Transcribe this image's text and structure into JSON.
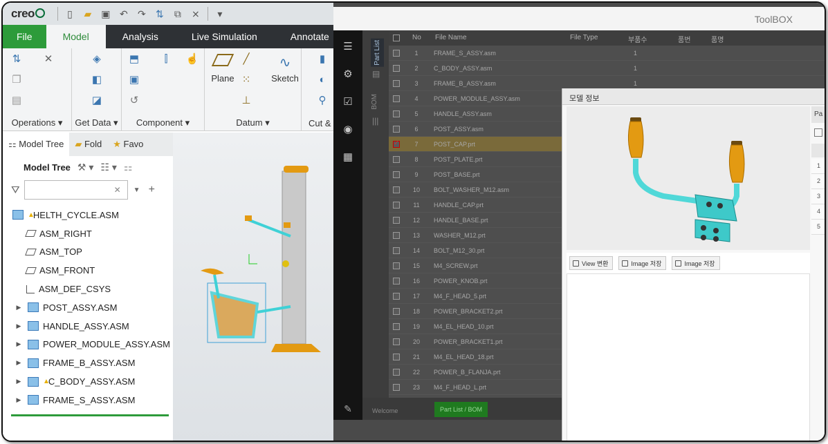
{
  "creo": {
    "logo": "creo",
    "tabs": [
      "File",
      "Model",
      "Analysis",
      "Live Simulation",
      "Annotate"
    ],
    "ribbon_groups": [
      "Operations",
      "Get Data",
      "Component",
      "Datum",
      "Cut &"
    ],
    "ribbon_buttons": {
      "plane": "Plane",
      "sketch": "Sketch"
    },
    "panel_tabs": [
      "Model Tree",
      "Fold",
      "Favo"
    ],
    "model_tree_label": "Model Tree",
    "filter_placeholder": "",
    "tree": [
      {
        "label": "HELTH_CYCLE.ASM",
        "type": "root",
        "warn": true
      },
      {
        "label": "ASM_RIGHT",
        "type": "plane"
      },
      {
        "label": "ASM_TOP",
        "type": "plane"
      },
      {
        "label": "ASM_FRONT",
        "type": "plane"
      },
      {
        "label": "ASM_DEF_CSYS",
        "type": "csys"
      },
      {
        "label": "POST_ASSY.ASM",
        "type": "asm"
      },
      {
        "label": "HANDLE_ASSY.ASM",
        "type": "asm"
      },
      {
        "label": "POWER_MODULE_ASSY.ASM",
        "type": "asm"
      },
      {
        "label": "FRAME_B_ASSY.ASM",
        "type": "asm"
      },
      {
        "label": "C_BODY_ASSY.ASM",
        "type": "asm",
        "warn": true
      },
      {
        "label": "FRAME_S_ASSY.ASM",
        "type": "asm"
      }
    ]
  },
  "toolbox": {
    "title": "ToolBOX",
    "vertical_tabs": [
      "Part List",
      "BOM"
    ],
    "columns": [
      "No",
      "File Name",
      "File Type",
      "부품수",
      "품번",
      "품명"
    ],
    "rows": [
      {
        "no": "1",
        "name": "FRAME_S_ASSY.asm",
        "qty": "1"
      },
      {
        "no": "2",
        "name": "C_BODY_ASSY.asm",
        "qty": "1"
      },
      {
        "no": "3",
        "name": "FRAME_B_ASSY.asm",
        "qty": "1"
      },
      {
        "no": "4",
        "name": "POWER_MODULE_ASSY.asm",
        "qty": "1"
      },
      {
        "no": "5",
        "name": "HANDLE_ASSY.asm",
        "qty": ""
      },
      {
        "no": "6",
        "name": "POST_ASSY.asm",
        "qty": ""
      },
      {
        "no": "7",
        "name": "POST_CAP.prt",
        "qty": "",
        "checked": true
      },
      {
        "no": "8",
        "name": "POST_PLATE.prt",
        "qty": ""
      },
      {
        "no": "9",
        "name": "POST_BASE.prt",
        "qty": ""
      },
      {
        "no": "10",
        "name": "BOLT_WASHER_M12.asm",
        "qty": ""
      },
      {
        "no": "11",
        "name": "HANDLE_CAP.prt",
        "qty": ""
      },
      {
        "no": "12",
        "name": "HANDLE_BASE.prt",
        "qty": ""
      },
      {
        "no": "13",
        "name": "WASHER_M12.prt",
        "qty": ""
      },
      {
        "no": "14",
        "name": "BOLT_M12_30.prt",
        "qty": ""
      },
      {
        "no": "15",
        "name": "M4_SCREW.prt",
        "qty": ""
      },
      {
        "no": "16",
        "name": "POWER_KNOB.prt",
        "qty": ""
      },
      {
        "no": "17",
        "name": "M4_F_HEAD_5.prt",
        "qty": ""
      },
      {
        "no": "18",
        "name": "POWER_BRACKET2.prt",
        "qty": ""
      },
      {
        "no": "19",
        "name": "M4_EL_HEAD_10.prt",
        "qty": ""
      },
      {
        "no": "20",
        "name": "POWER_BRACKET1.prt",
        "qty": ""
      },
      {
        "no": "21",
        "name": "M4_EL_HEAD_18.prt",
        "qty": ""
      },
      {
        "no": "22",
        "name": "POWER_B_FLANJA.prt",
        "qty": ""
      },
      {
        "no": "23",
        "name": "M4_F_HEAD_L.prt",
        "qty": ""
      }
    ],
    "bottom_tabs": [
      "Welcome",
      "Part List / BOM"
    ]
  },
  "dialog": {
    "title": "모델 정보",
    "buttons": [
      "View 변환",
      "Image 저장",
      "Image 저장"
    ],
    "right_header": "Pa",
    "right_rows": [
      "1",
      "2",
      "3",
      "4",
      "5"
    ]
  }
}
